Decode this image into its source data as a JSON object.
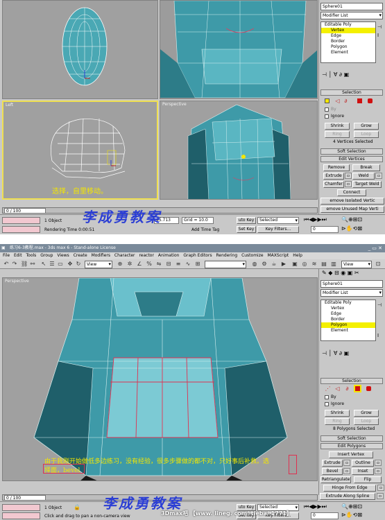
{
  "top": {
    "viewports": {
      "left_label": "Left",
      "persp_label": "Perspective"
    },
    "object_name": "Sphere01",
    "modifier_list": "Modifier List",
    "stack": [
      "Editable Poly",
      "Vertex",
      "Edge",
      "Border",
      "Polygon",
      "Element"
    ],
    "stack_selected": "Vertex",
    "selection_title": "Selection",
    "by_label": "By",
    "ignore_label": "Ignore",
    "shrink": "Shrink",
    "grow": "Grow",
    "ring": "Ring",
    "loop": "Loop",
    "selected_status": "4 Vertices Selected",
    "soft_selection": "Soft Selection",
    "edit_title": "Edit Vertices",
    "edit_buttons": [
      "Remove",
      "Break",
      "Extrude",
      "Weld",
      "Chamfer",
      "Target Weld",
      "Connect",
      "emove Isolated Vertic",
      "emove Unused Map Verti"
    ],
    "caption": "选择，自里移动。",
    "watermark": "李成勇教案",
    "timeline": "0 / 100",
    "status": {
      "objects": "1 Object",
      "rendering": "Rendering Time  0:00:51",
      "x_val": "45.713",
      "grid": "Grid = 10.0",
      "add_tag": "Add Time Tag",
      "auto_key": "uto Key",
      "set_key": "Set Key",
      "selected": "Selected",
      "key_filters": "Key Filters...",
      "frame": "0"
    }
  },
  "bottom": {
    "title": "练习6-3教程.max - 3ds max 6 - Stand-alone License",
    "menu": [
      "File",
      "Edit",
      "Tools",
      "Group",
      "Views",
      "Create",
      "Modifiers",
      "Character",
      "reactor",
      "Animation",
      "Graph Editors",
      "Rendering",
      "Customize",
      "MAXScript",
      "Help"
    ],
    "view_dropdown": "View",
    "view_dropdown2": "View",
    "viewport_label": "Perspective",
    "object_name": "Sphere01",
    "modifier_list": "Modifier List",
    "stack": [
      "Editable Poly",
      "Vertex",
      "Edge",
      "Border",
      "Polygon",
      "Element"
    ],
    "stack_selected": "Polygon",
    "selection_title": "Selection",
    "by_label": "By",
    "ignore_label": "Ignore",
    "shrink": "Shrink",
    "grow": "Grow",
    "ring": "Ring",
    "loop": "Loop",
    "selected_status": "8 Polygons Selected",
    "soft_selection": "Soft Selection",
    "edit_title": "Edit Polygons",
    "edit_buttons": [
      "Insert Vertex",
      "Extrude",
      "Outline",
      "Bevel",
      "Inset",
      "Retriangulate",
      "Flip",
      "Hinge From Edge",
      "Extrude Along Spline"
    ],
    "caption_line1": "由于我刚开始做低多边练习，没有经验，很多步骤做的都不对，只好事后补救。选",
    "caption_line2": "择面，bevel",
    "watermark": "李成勇教案",
    "timeline": "0 / 100",
    "status": {
      "objects": "1 Object",
      "prompt": "Click and drag to pan a non-camera view",
      "auto_key": "uto Key",
      "set_key": "Set Key",
      "selected": "Selected",
      "key_filters": "Key Filters...",
      "frame": "0"
    },
    "site_watermark": "3Dmax吧 【www. lineg. com/ tieba/ 1771】"
  }
}
